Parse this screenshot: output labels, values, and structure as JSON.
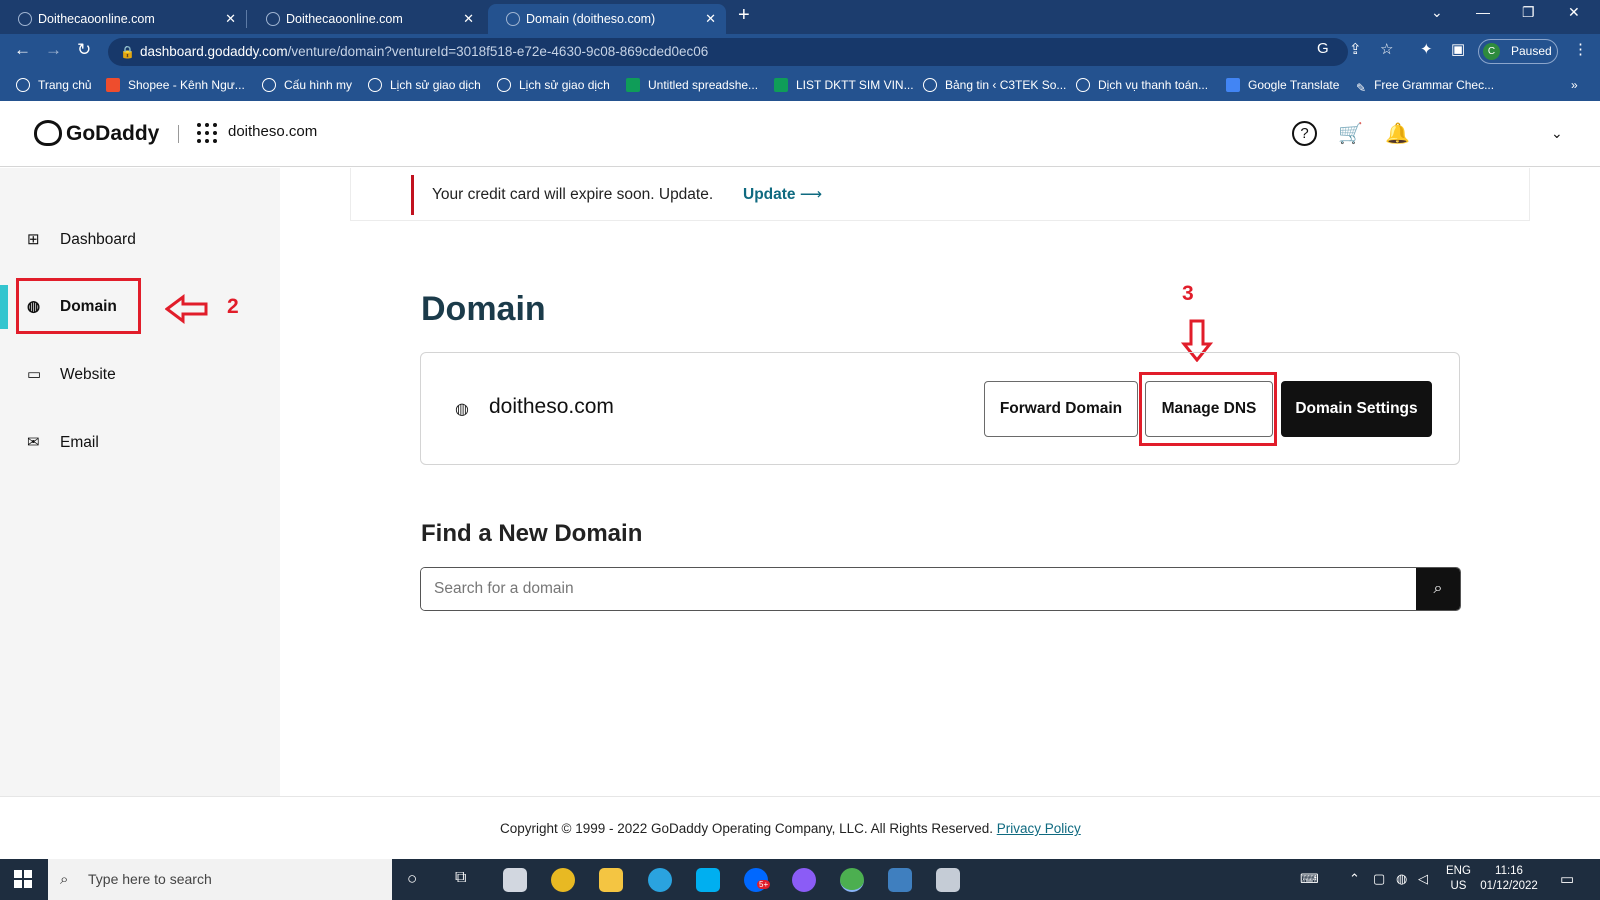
{
  "browser": {
    "tabs": [
      {
        "label": "Doithecaoonline.com",
        "active": false
      },
      {
        "label": "Doithecaoonline.com",
        "active": false
      },
      {
        "label": "Domain (doitheso.com)",
        "active": true
      }
    ],
    "url_host": "dashboard.godaddy.com",
    "url_path": "/venture/domain?ventureId=3018f518-e72e-4630-9c08-869cded0ec06",
    "profile_initial": "C",
    "profile_status": "Paused",
    "bookmarks": [
      "Trang chủ",
      "Shopee - Kênh Ngư...",
      "Cấu hình my",
      "Lịch sử giao dịch",
      "Lịch sử giao dịch",
      "Untitled spreadshe...",
      "LIST DKTT SIM VIN...",
      "Bảng tin ‹ C3TEK So...",
      "Dịch vụ thanh toán...",
      "Google Translate",
      "Free Grammar Chec..."
    ]
  },
  "header": {
    "brand": "GoDaddy",
    "venture": "doitheso.com"
  },
  "sidebar": {
    "items": [
      {
        "label": "Dashboard",
        "icon": "grid-icon"
      },
      {
        "label": "Domain",
        "icon": "globe-icon",
        "active": true
      },
      {
        "label": "Website",
        "icon": "browser-window-icon"
      },
      {
        "label": "Email",
        "icon": "envelope-icon"
      }
    ]
  },
  "annotations": {
    "step2": "2",
    "step3": "3",
    "color": "#e11d2a"
  },
  "banner": {
    "text": "Your credit card will expire soon. Update.",
    "link": "Update"
  },
  "main": {
    "title": "Domain",
    "domain": "doitheso.com",
    "buttons": {
      "forward": "Forward Domain",
      "dns": "Manage DNS",
      "settings": "Domain Settings"
    },
    "find_title": "Find a New Domain",
    "search_placeholder": "Search for a domain"
  },
  "footer": {
    "copyright": "Copyright © 1999 - 2022 GoDaddy Operating Company, LLC. All Rights Reserved.",
    "privacy": "Privacy Policy"
  },
  "taskbar": {
    "search_placeholder": "Type here to search",
    "lang": "ENG",
    "region": "US",
    "time": "11:16",
    "date": "01/12/2022",
    "badge": "5+"
  },
  "colors": {
    "browser_chrome": "#24528f",
    "accent_teal": "#34c5cf",
    "link_teal": "#0f6a80",
    "alert_red": "#c1121f"
  }
}
